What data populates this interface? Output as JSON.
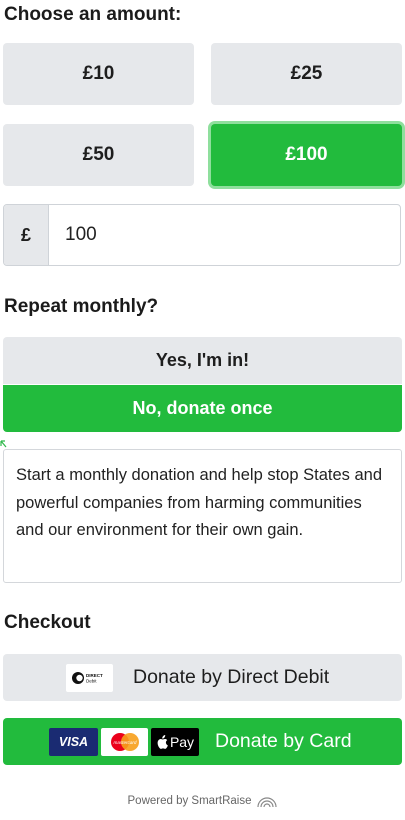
{
  "amounts": {
    "heading": "Choose an amount:",
    "options": [
      "£10",
      "£25",
      "£50",
      "£100"
    ],
    "selected": "£100",
    "currency_symbol": "£",
    "custom_value": "100"
  },
  "repeat": {
    "heading": "Repeat monthly?",
    "yes_label": "Yes, I'm in!",
    "no_label": "No, donate once",
    "selected": "No, donate once",
    "description": "Start a monthly donation and help stop States and powerful companies from harming communities and our environment for their own gain."
  },
  "checkout": {
    "heading": "Checkout",
    "direct_debit_label": "Donate by Direct Debit",
    "direct_debit_logo_text": "DIRECT Debit",
    "card_label": "Donate by Card",
    "card_logos": [
      "VISA",
      "mastercard",
      "Pay"
    ]
  },
  "footer": {
    "powered_by": "Powered by SmartRaise"
  },
  "colors": {
    "accent_green": "#22bb3d",
    "neutral_button": "#e6e8eb",
    "selected_ring": "#8fdf9d"
  }
}
